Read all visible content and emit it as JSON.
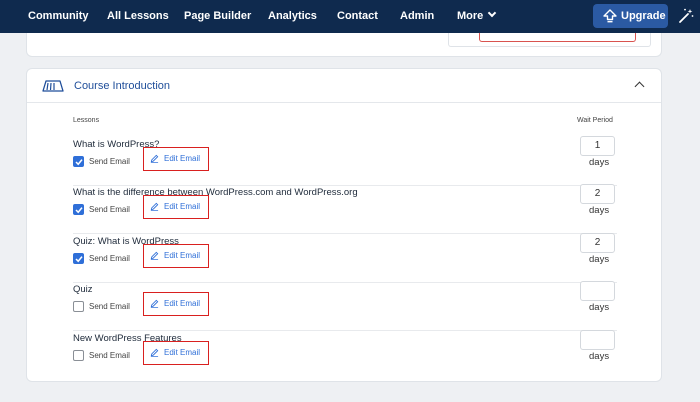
{
  "nav": {
    "items": [
      {
        "id": "community",
        "label": "Community"
      },
      {
        "id": "all-lessons",
        "label": "All Lessons"
      },
      {
        "id": "page-builder",
        "label": "Page Builder"
      },
      {
        "id": "analytics",
        "label": "Analytics"
      },
      {
        "id": "contact",
        "label": "Contact"
      },
      {
        "id": "admin",
        "label": "Admin"
      }
    ],
    "more_label": "More",
    "upgrade_label": "Upgrade"
  },
  "section": {
    "title": "Course Introduction",
    "col_lessons": "Lessons",
    "col_wait": "Wait Period"
  },
  "lessons": [
    {
      "title": "What is WordPress?",
      "send_label": "Send Email",
      "checked": true,
      "edit_label": "Edit Email",
      "wait": "1",
      "unit": "days"
    },
    {
      "title": "What is the difference between WordPress.com and WordPress.org",
      "send_label": "Send Email",
      "checked": true,
      "edit_label": "Edit Email",
      "wait": "2",
      "unit": "days"
    },
    {
      "title": "Quiz: What is WordPress",
      "send_label": "Send Email",
      "checked": true,
      "edit_label": "Edit Email",
      "wait": "2",
      "unit": "days"
    },
    {
      "title": "Quiz",
      "send_label": "Send Email",
      "checked": false,
      "edit_label": "Edit Email",
      "wait": "",
      "unit": "days"
    },
    {
      "title": "New WordPress Features",
      "send_label": "Send Email",
      "checked": false,
      "edit_label": "Edit Email",
      "wait": "",
      "unit": "days"
    }
  ],
  "colors": {
    "nav_bg": "#0f2a4e",
    "accent": "#2f6fd8",
    "highlight": "#d9201f"
  }
}
